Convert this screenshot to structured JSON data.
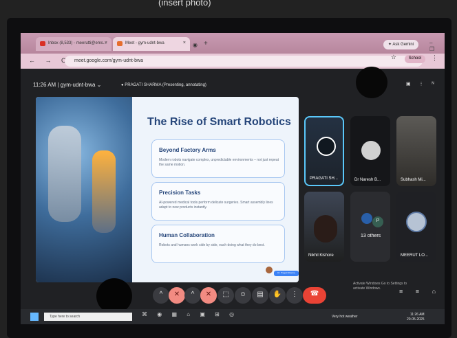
{
  "top_note": "(insert photo)",
  "browser": {
    "tabs": [
      {
        "label": "Inbox (8,533) - meerutti@ems...",
        "icon_color": "#d93025"
      },
      {
        "label": "Meet - gym-udnt-bwa",
        "icon_color": "#e66e2e"
      }
    ],
    "new_tab_label": "+",
    "ask_gemini": "Ask Gemini",
    "window_controls": "– ❐ ✕",
    "nav_buttons": "← → C",
    "url": "meet.google.com/gym-udnt-bwa",
    "profile_label": "School",
    "bookmark_icon": "star-icon",
    "menu_icon": "⋮"
  },
  "meet": {
    "time": "11:26 AM",
    "meeting_code": "gym-udnt-bwa",
    "presenter": "PRAGATI SHARMA (Presenting, annotating)",
    "header_icons": "▣ ⋮ ᴺ"
  },
  "slide": {
    "title": "The Rise of Smart Robotics",
    "cards": [
      {
        "title": "Beyond Factory Arms",
        "text": "Modern robots navigate complex, unpredictable environments – not just repeat the same motion."
      },
      {
        "title": "Precision Tasks",
        "text": "AI-powered medical tools perform delicate surgeries. Smart assembly lines adapt to new products instantly."
      },
      {
        "title": "Human Collaboration",
        "text": "Robots and humans work side by side, each doing what they do best."
      }
    ],
    "badge": "Dr. Pragati Sharma"
  },
  "participants": [
    {
      "name": "PRAGATI SH..."
    },
    {
      "name": "Dr Naresh B..."
    },
    {
      "name": "Subhash Mi..."
    },
    {
      "name": "Nikhil Kishore"
    },
    {
      "name": "13 others",
      "avatar_letter": "P"
    },
    {
      "name": "MEERUT LO..."
    }
  ],
  "controls": {
    "items": [
      "^",
      "✕",
      "^",
      "✕",
      "⬚",
      "☺",
      "▤",
      "✋",
      "⋮"
    ],
    "end_call": "☎",
    "right": [
      "≡",
      "≡",
      "⌂"
    ]
  },
  "watermark": "Activate Windows Go to Settings to activate Windows.",
  "taskbar": {
    "search_placeholder": "Type here to search",
    "apps": [
      "⌘",
      "◉",
      "▦",
      "⌂",
      "▣",
      "⊞",
      "◎"
    ],
    "weather": "Very hot weather",
    "time": "11:26 AM",
    "date": "20-05-2025"
  }
}
